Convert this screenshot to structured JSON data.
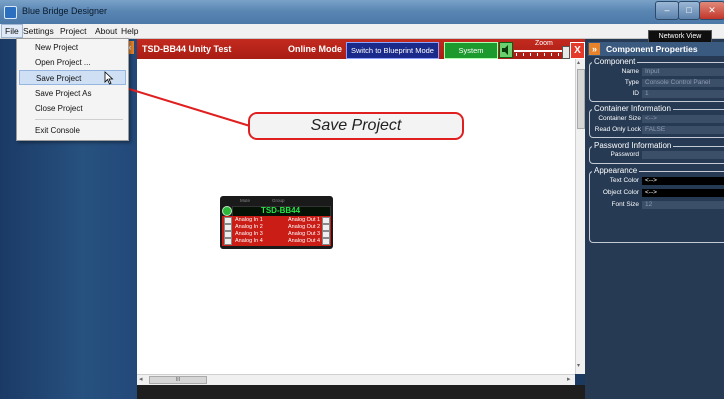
{
  "window": {
    "title": "Blue Bridge Designer",
    "controls": [
      "–",
      "□",
      "✕"
    ]
  },
  "menubar": {
    "items": [
      "File",
      "Settings",
      "Project",
      "About",
      "Help"
    ]
  },
  "file_menu": {
    "items": [
      "New Project",
      "Open Project ...",
      "Save Project",
      "Save Project As",
      "Close Project",
      "Exit Console"
    ],
    "highlighted": "Save Project"
  },
  "header": {
    "device_title": "TSD-BB44 Unity Test",
    "mode": "Online Mode",
    "blueprint_button": "Switch to Blueprint Mode",
    "presets_button": "System Presets",
    "zoom_label": "Zoom",
    "close": "X",
    "collapse_left": "«"
  },
  "device": {
    "name": "TSD-BB44",
    "top_labels": [
      "Mute",
      "Group"
    ],
    "inputs": [
      "Analog In 1",
      "Analog In 2",
      "Analog In 3",
      "Analog In 4"
    ],
    "outputs": [
      "Analog Out 1",
      "Analog Out 2",
      "Analog Out 3",
      "Analog Out 4"
    ]
  },
  "callout": {
    "text": "Save Project"
  },
  "scroll": {
    "grip": "III",
    "left_arrow": "◂",
    "right_arrow": "▸",
    "up_arrow": "▴",
    "down_arrow": "▾"
  },
  "right_panel": {
    "network_view": "Network View",
    "arrow": "»",
    "title": "Component Properties",
    "component": {
      "title": "Component",
      "name_label": "Name",
      "name_value": "Input",
      "type_label": "Type",
      "type_value": "Console Control Panel",
      "id_label": "ID",
      "id_value": "1"
    },
    "container": {
      "title": "Container Information",
      "size_label": "Container Size",
      "size_value": "<-->",
      "readonly_label": "Read Only Lock",
      "readonly_value": "FALSE"
    },
    "password": {
      "title": "Password Information",
      "label": "Password",
      "value": ""
    },
    "appearance": {
      "title": "Appearance",
      "text_color_label": "Text Color",
      "text_color_value": "<-->",
      "object_color_label": "Object Color",
      "object_color_value": "<-->",
      "font_size_label": "Font Size",
      "font_size_value": "12"
    }
  },
  "colors": {
    "header_red": "#b82218",
    "accent_orange": "#e9832a",
    "callout_border": "#e02020"
  }
}
